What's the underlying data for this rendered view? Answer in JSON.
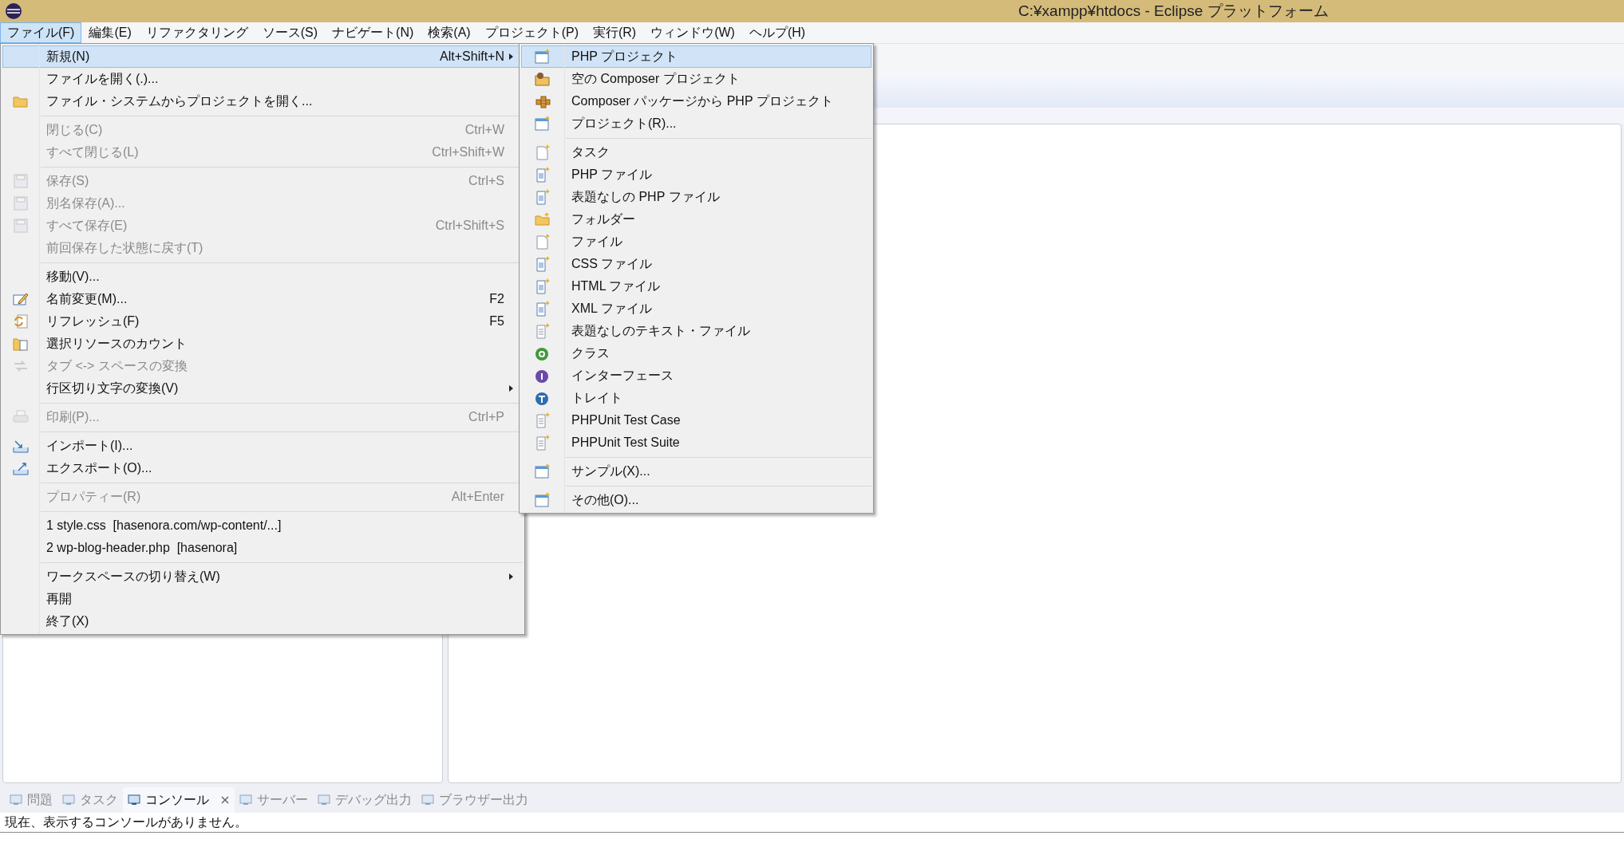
{
  "window": {
    "title": "C:¥xampp¥htdocs - Eclipse プラットフォーム"
  },
  "menu_bar": [
    {
      "label": "ファイル(F)",
      "selected": true
    },
    {
      "label": "編集(E)",
      "selected": false
    },
    {
      "label": "リファクタリング",
      "selected": false
    },
    {
      "label": "ソース(S)",
      "selected": false
    },
    {
      "label": "ナビゲート(N)",
      "selected": false
    },
    {
      "label": "検索(A)",
      "selected": false
    },
    {
      "label": "プロジェクト(P)",
      "selected": false
    },
    {
      "label": "実行(R)",
      "selected": false
    },
    {
      "label": "ウィンドウ(W)",
      "selected": false
    },
    {
      "label": "ヘルプ(H)",
      "selected": false
    }
  ],
  "file_menu": [
    {
      "kind": "item",
      "label": "新規(N)",
      "shortcut": "Alt+Shift+N",
      "submenu": true,
      "disabled": false,
      "selected": true
    },
    {
      "kind": "item",
      "label": "ファイルを開く(.)...",
      "disabled": false,
      "selected": false
    },
    {
      "kind": "item",
      "label": "ファイル・システムからプロジェクトを開く...",
      "disabled": false,
      "selected": false
    },
    {
      "kind": "separator"
    },
    {
      "kind": "item",
      "label": "閉じる(C)",
      "shortcut": "Ctrl+W",
      "disabled": true,
      "selected": false
    },
    {
      "kind": "item",
      "label": "すべて閉じる(L)",
      "shortcut": "Ctrl+Shift+W",
      "disabled": true,
      "selected": false
    },
    {
      "kind": "separator"
    },
    {
      "kind": "item",
      "label": "保存(S)",
      "shortcut": "Ctrl+S",
      "disabled": true,
      "selected": false
    },
    {
      "kind": "item",
      "label": "別名保存(A)...",
      "disabled": true,
      "selected": false
    },
    {
      "kind": "item",
      "label": "すべて保存(E)",
      "shortcut": "Ctrl+Shift+S",
      "disabled": true,
      "selected": false
    },
    {
      "kind": "item",
      "label": "前回保存した状態に戻す(T)",
      "disabled": true,
      "selected": false
    },
    {
      "kind": "separator"
    },
    {
      "kind": "item",
      "label": "移動(V)...",
      "disabled": false,
      "selected": false
    },
    {
      "kind": "item",
      "label": "名前変更(M)...",
      "shortcut": "F2",
      "disabled": false,
      "selected": false
    },
    {
      "kind": "item",
      "label": "リフレッシュ(F)",
      "shortcut": "F5",
      "disabled": false,
      "selected": false
    },
    {
      "kind": "item",
      "label": "選択リソースのカウント",
      "disabled": false,
      "selected": false
    },
    {
      "kind": "item",
      "label": "タブ <-> スペースの変換",
      "disabled": true,
      "selected": false
    },
    {
      "kind": "item",
      "label": "行区切り文字の変換(V)",
      "submenu": true,
      "disabled": false,
      "selected": false
    },
    {
      "kind": "separator"
    },
    {
      "kind": "item",
      "label": "印刷(P)...",
      "shortcut": "Ctrl+P",
      "disabled": true,
      "selected": false
    },
    {
      "kind": "separator"
    },
    {
      "kind": "item",
      "label": "インポート(I)...",
      "disabled": false,
      "selected": false
    },
    {
      "kind": "item",
      "label": "エクスポート(O)...",
      "disabled": false,
      "selected": false
    },
    {
      "kind": "separator"
    },
    {
      "kind": "item",
      "label": "プロパティー(R)",
      "shortcut": "Alt+Enter",
      "disabled": true,
      "selected": false
    },
    {
      "kind": "separator"
    },
    {
      "kind": "item",
      "label": "1 style.css  [hasenora.com/wp-content/...]",
      "disabled": false,
      "selected": false
    },
    {
      "kind": "item",
      "label": "2 wp-blog-header.php  [hasenora]",
      "disabled": false,
      "selected": false
    },
    {
      "kind": "separator"
    },
    {
      "kind": "item",
      "label": "ワークスペースの切り替え(W)",
      "submenu": true,
      "disabled": false,
      "selected": false
    },
    {
      "kind": "item",
      "label": "再開",
      "disabled": false,
      "selected": false
    },
    {
      "kind": "item",
      "label": "終了(X)",
      "disabled": false,
      "selected": false
    }
  ],
  "new_submenu": [
    {
      "kind": "item",
      "label": "PHP プロジェクト",
      "selected": true
    },
    {
      "kind": "item",
      "label": "空の Composer プロジェクト",
      "selected": false
    },
    {
      "kind": "item",
      "label": "Composer パッケージから PHP プロジェクト",
      "selected": false
    },
    {
      "kind": "item",
      "label": "プロジェクト(R)...",
      "selected": false
    },
    {
      "kind": "separator"
    },
    {
      "kind": "item",
      "label": "タスク",
      "selected": false
    },
    {
      "kind": "item",
      "label": "PHP ファイル",
      "selected": false
    },
    {
      "kind": "item",
      "label": "表題なしの PHP ファイル",
      "selected": false
    },
    {
      "kind": "item",
      "label": "フォルダー",
      "selected": false
    },
    {
      "kind": "item",
      "label": "ファイル",
      "selected": false
    },
    {
      "kind": "item",
      "label": "CSS ファイル",
      "selected": false
    },
    {
      "kind": "item",
      "label": "HTML ファイル",
      "selected": false
    },
    {
      "kind": "item",
      "label": "XML ファイル",
      "selected": false
    },
    {
      "kind": "item",
      "label": "表題なしのテキスト・ファイル",
      "selected": false
    },
    {
      "kind": "item",
      "label": "クラス",
      "selected": false
    },
    {
      "kind": "item",
      "label": "インターフェース",
      "selected": false
    },
    {
      "kind": "item",
      "label": "トレイト",
      "selected": false
    },
    {
      "kind": "item",
      "label": "PHPUnit Test Case",
      "selected": false
    },
    {
      "kind": "item",
      "label": "PHPUnit Test Suite",
      "selected": false
    },
    {
      "kind": "separator"
    },
    {
      "kind": "item",
      "label": "サンプル(X)...",
      "selected": false
    },
    {
      "kind": "separator"
    },
    {
      "kind": "item",
      "label": "その他(O)...",
      "selected": false
    }
  ],
  "bottom_tabs": [
    {
      "label": "問題",
      "selected": false
    },
    {
      "label": "タスク",
      "selected": false
    },
    {
      "label": "コンソール",
      "selected": true
    },
    {
      "label": "サーバー",
      "selected": false
    },
    {
      "label": "デバッグ出力",
      "selected": false
    },
    {
      "label": "ブラウザー出力",
      "selected": false
    }
  ],
  "console": {
    "message": "現在、表示するコンソールがありません。"
  }
}
